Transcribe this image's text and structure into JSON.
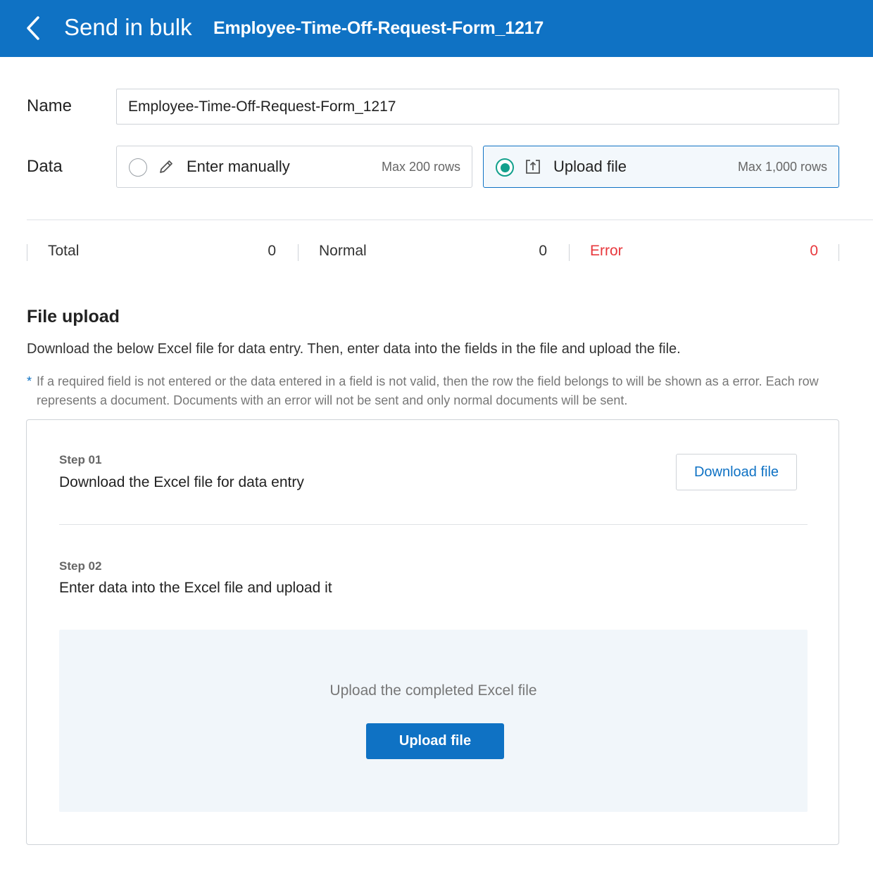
{
  "header": {
    "page_title": "Send in bulk",
    "document_title": "Employee-Time-Off-Request-Form_1217",
    "bg_color": "#0f72c4"
  },
  "form": {
    "name_label": "Name",
    "name_value": "Employee-Time-Off-Request-Form_1217",
    "data_label": "Data",
    "options": [
      {
        "label": "Enter manually",
        "max": "Max 200 rows",
        "icon": "pencil-icon",
        "selected": false
      },
      {
        "label": "Upload file",
        "max": "Max 1,000 rows",
        "icon": "upload-box-icon",
        "selected": true
      }
    ]
  },
  "stats": [
    {
      "label": "Total",
      "value": "0",
      "status": "normal"
    },
    {
      "label": "Normal",
      "value": "0",
      "status": "normal"
    },
    {
      "label": "Error",
      "value": "0",
      "status": "error",
      "color": "#e8383d"
    }
  ],
  "file_upload": {
    "title": "File upload",
    "description": "Download the below Excel file for data entry. Then, enter data into the fields in the file and upload the file.",
    "note_marker": "*",
    "note": "If a required field is not entered or the data entered in a field is not valid, then the row the field belongs to will be shown as a error. Each row represents a document. Documents with an error will not be sent and only normal documents will be sent.",
    "steps": [
      {
        "number": "Step 01",
        "title": "Download the Excel file for data entry",
        "button": "Download file"
      },
      {
        "number": "Step 02",
        "title": "Enter data into the Excel file and upload it"
      }
    ],
    "upload_prompt": "Upload the completed Excel file",
    "upload_button": "Upload file"
  },
  "colors": {
    "accent": "#0f72c4",
    "radio_selected": "#12a08c",
    "error": "#e8383d"
  }
}
